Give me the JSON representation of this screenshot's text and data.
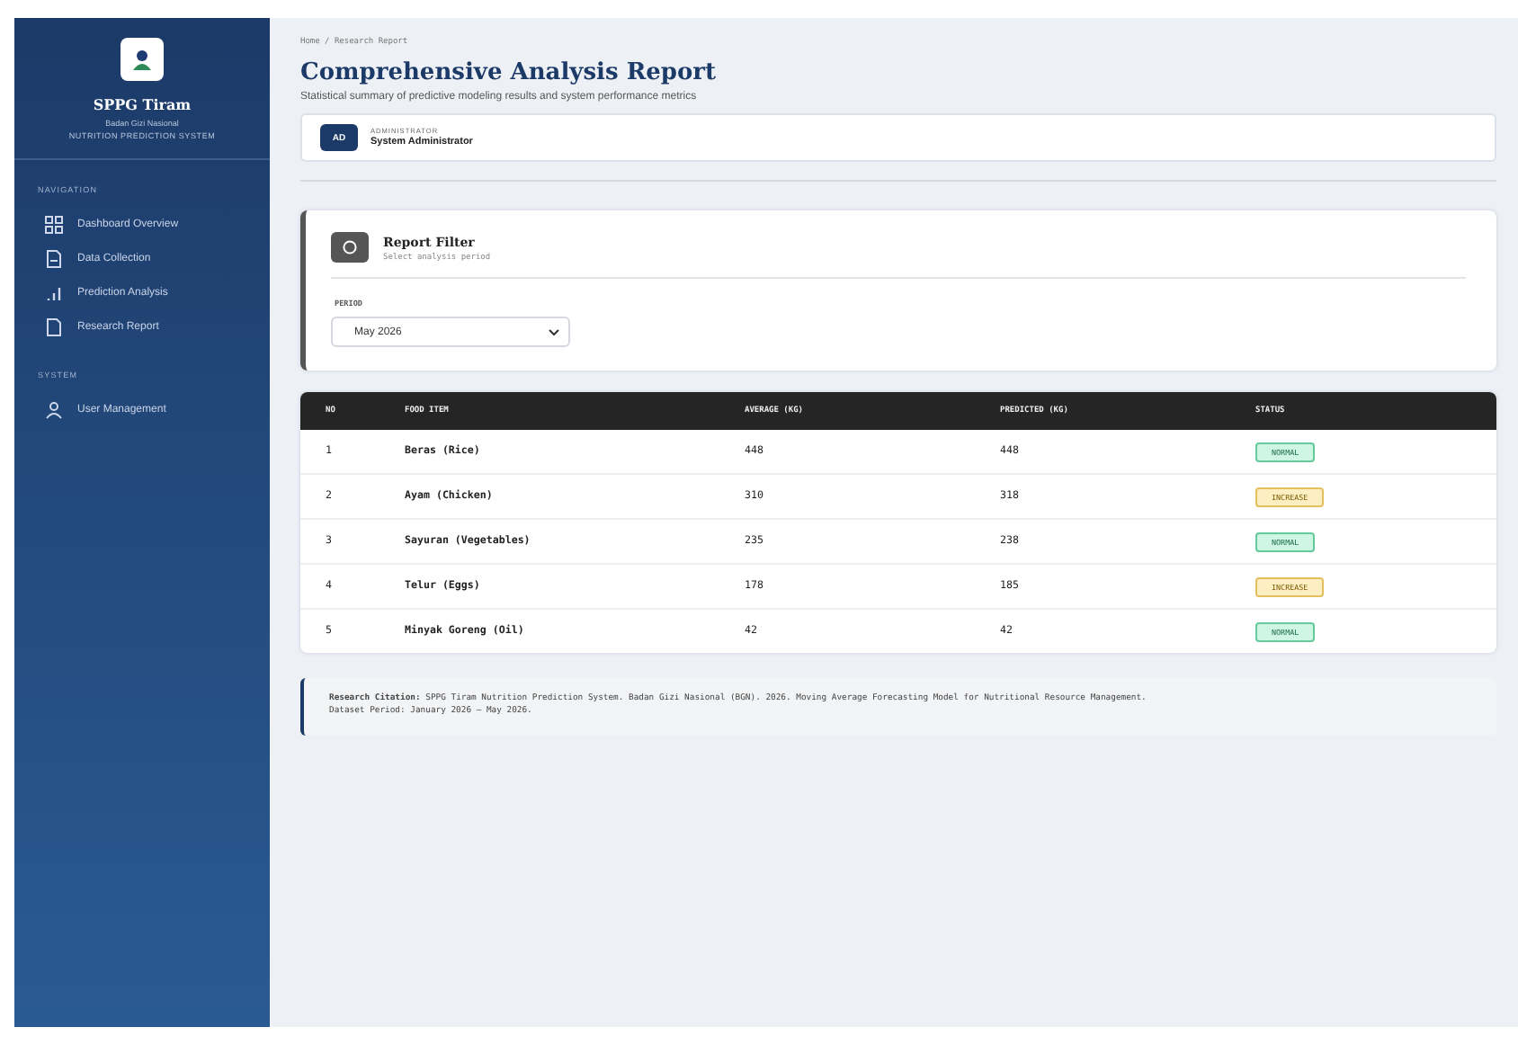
{
  "sidebar": {
    "brand": "SPPG Tiram",
    "subtitle": "Badan Gizi Nasional",
    "tagline": "NUTRITION PREDICTION SYSTEM",
    "sections": [
      {
        "heading": "NAVIGATION",
        "items": [
          {
            "label": "Dashboard Overview",
            "kind": "grid",
            "selected": false
          },
          {
            "label": "Data Collection",
            "kind": "doc",
            "selected": false
          },
          {
            "label": "Prediction Analysis",
            "kind": "bars",
            "selected": false
          },
          {
            "label": "Research Report",
            "kind": "file",
            "selected": false
          }
        ]
      },
      {
        "heading": "SYSTEM",
        "items": [
          {
            "label": "User Management",
            "kind": "user",
            "selected": false
          }
        ]
      }
    ]
  },
  "breadcrumb": "Home / Research Report",
  "title": "Comprehensive Analysis Report",
  "description": "Statistical summary of predictive modeling results and system performance metrics",
  "user": {
    "initials": "AD",
    "role": "ADMINISTRATOR",
    "name": "System Administrator"
  },
  "filter": {
    "title": "Report Filter",
    "subtitle": "Select analysis period",
    "field_label": "PERIOD",
    "value": "May 2026"
  },
  "table": {
    "columns": [
      "NO",
      "FOOD ITEM",
      "AVERAGE (KG)",
      "PREDICTED (KG)",
      "STATUS"
    ],
    "rows": [
      {
        "no": "1",
        "item": "Beras (Rice)",
        "average": "448",
        "predicted": "448",
        "status": "NORMAL",
        "kind": "normal"
      },
      {
        "no": "2",
        "item": "Ayam (Chicken)",
        "average": "310",
        "predicted": "318",
        "status": "INCREASE",
        "kind": "increase"
      },
      {
        "no": "3",
        "item": "Sayuran (Vegetables)",
        "average": "235",
        "predicted": "238",
        "status": "NORMAL",
        "kind": "normal"
      },
      {
        "no": "4",
        "item": "Telur (Eggs)",
        "average": "178",
        "predicted": "185",
        "status": "INCREASE",
        "kind": "increase"
      },
      {
        "no": "5",
        "item": "Minyak Goreng (Oil)",
        "average": "42",
        "predicted": "42",
        "status": "NORMAL",
        "kind": "normal"
      }
    ]
  },
  "citation": {
    "text": "**Research Citation:** SPPG Tiram Nutrition Prediction System. Badan Gizi Nasional (BGN). 2026. Moving Average Forecasting Model for Nutritional Resource Management.",
    "period": "Dataset Period: January 2026 – May 2026."
  }
}
